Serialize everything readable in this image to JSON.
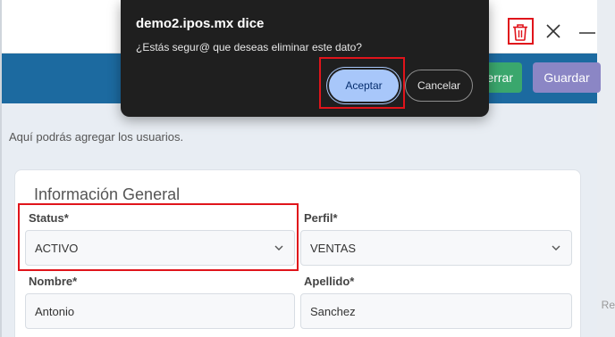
{
  "dialog": {
    "title": "demo2.ipos.mx dice",
    "message": "¿Estás segur@ que deseas eliminar este dato?",
    "accept_label": "Aceptar",
    "cancel_label": "Cancelar"
  },
  "toolbar": {
    "close_label": "errar",
    "save_label": "Guardar"
  },
  "page": {
    "description": "Aquí podrás agregar los usuarios.",
    "section_title": "Información General",
    "right_edge_text": "Re"
  },
  "form": {
    "status": {
      "label": "Status*",
      "value": "ACTIVO"
    },
    "perfil": {
      "label": "Perfil*",
      "value": "VENTAS"
    },
    "nombre": {
      "label": "Nombre*",
      "value": "Antonio"
    },
    "apellido": {
      "label": "Apellido*",
      "value": "Sanchez"
    }
  },
  "icons": [
    "trash-icon",
    "close-icon",
    "minimize-icon",
    "chevron-down-icon"
  ],
  "colors": {
    "header_bar": "#1c6aa0",
    "save_button": "#8b86c5",
    "close_button": "#3aa76d",
    "dialog_bg": "#1f1f1f",
    "accept_button": "#a8c7fa",
    "highlight": "#e0141b"
  }
}
